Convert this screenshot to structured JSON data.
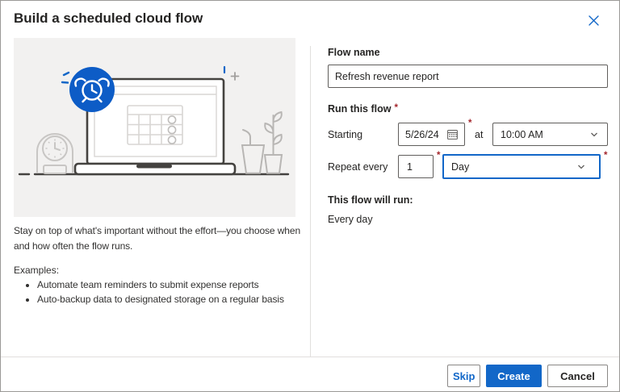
{
  "dialog": {
    "title": "Build a scheduled cloud flow"
  },
  "icons": {
    "close": "x-cross",
    "calendar": "calendar-grid",
    "chevron_down": "chevron-down",
    "alarm_badge": "alarm-clock-in-blue-circle"
  },
  "left": {
    "description": "Stay on top of what's important without the effort—you choose when and how often the flow runs.",
    "examples_heading": "Examples:",
    "examples": [
      "Automate team reminders to submit expense reports",
      "Auto-backup data to designated storage on a regular basis"
    ]
  },
  "form": {
    "flow_name_label": "Flow name",
    "flow_name_value": "Refresh revenue report",
    "run_this_flow_label": "Run this flow",
    "required_marker": "*",
    "starting_label": "Starting",
    "starting_date": "5/26/24",
    "at_label": "at",
    "time_value": "10:00 AM",
    "repeat_every_label": "Repeat every",
    "interval_value": "1",
    "frequency_value": "Day",
    "summary_label": "This flow will run:",
    "summary_value": "Every day"
  },
  "footer": {
    "skip_label": "Skip",
    "create_label": "Create",
    "cancel_label": "Cancel"
  },
  "colors": {
    "accent_blue": "#1267C8",
    "badge_blue": "#0D5CC6",
    "required_red": "#A4262C",
    "field_border": "#605E5C",
    "divider": "#E1DFDD",
    "illustration_bg": "#F2F1F0"
  }
}
